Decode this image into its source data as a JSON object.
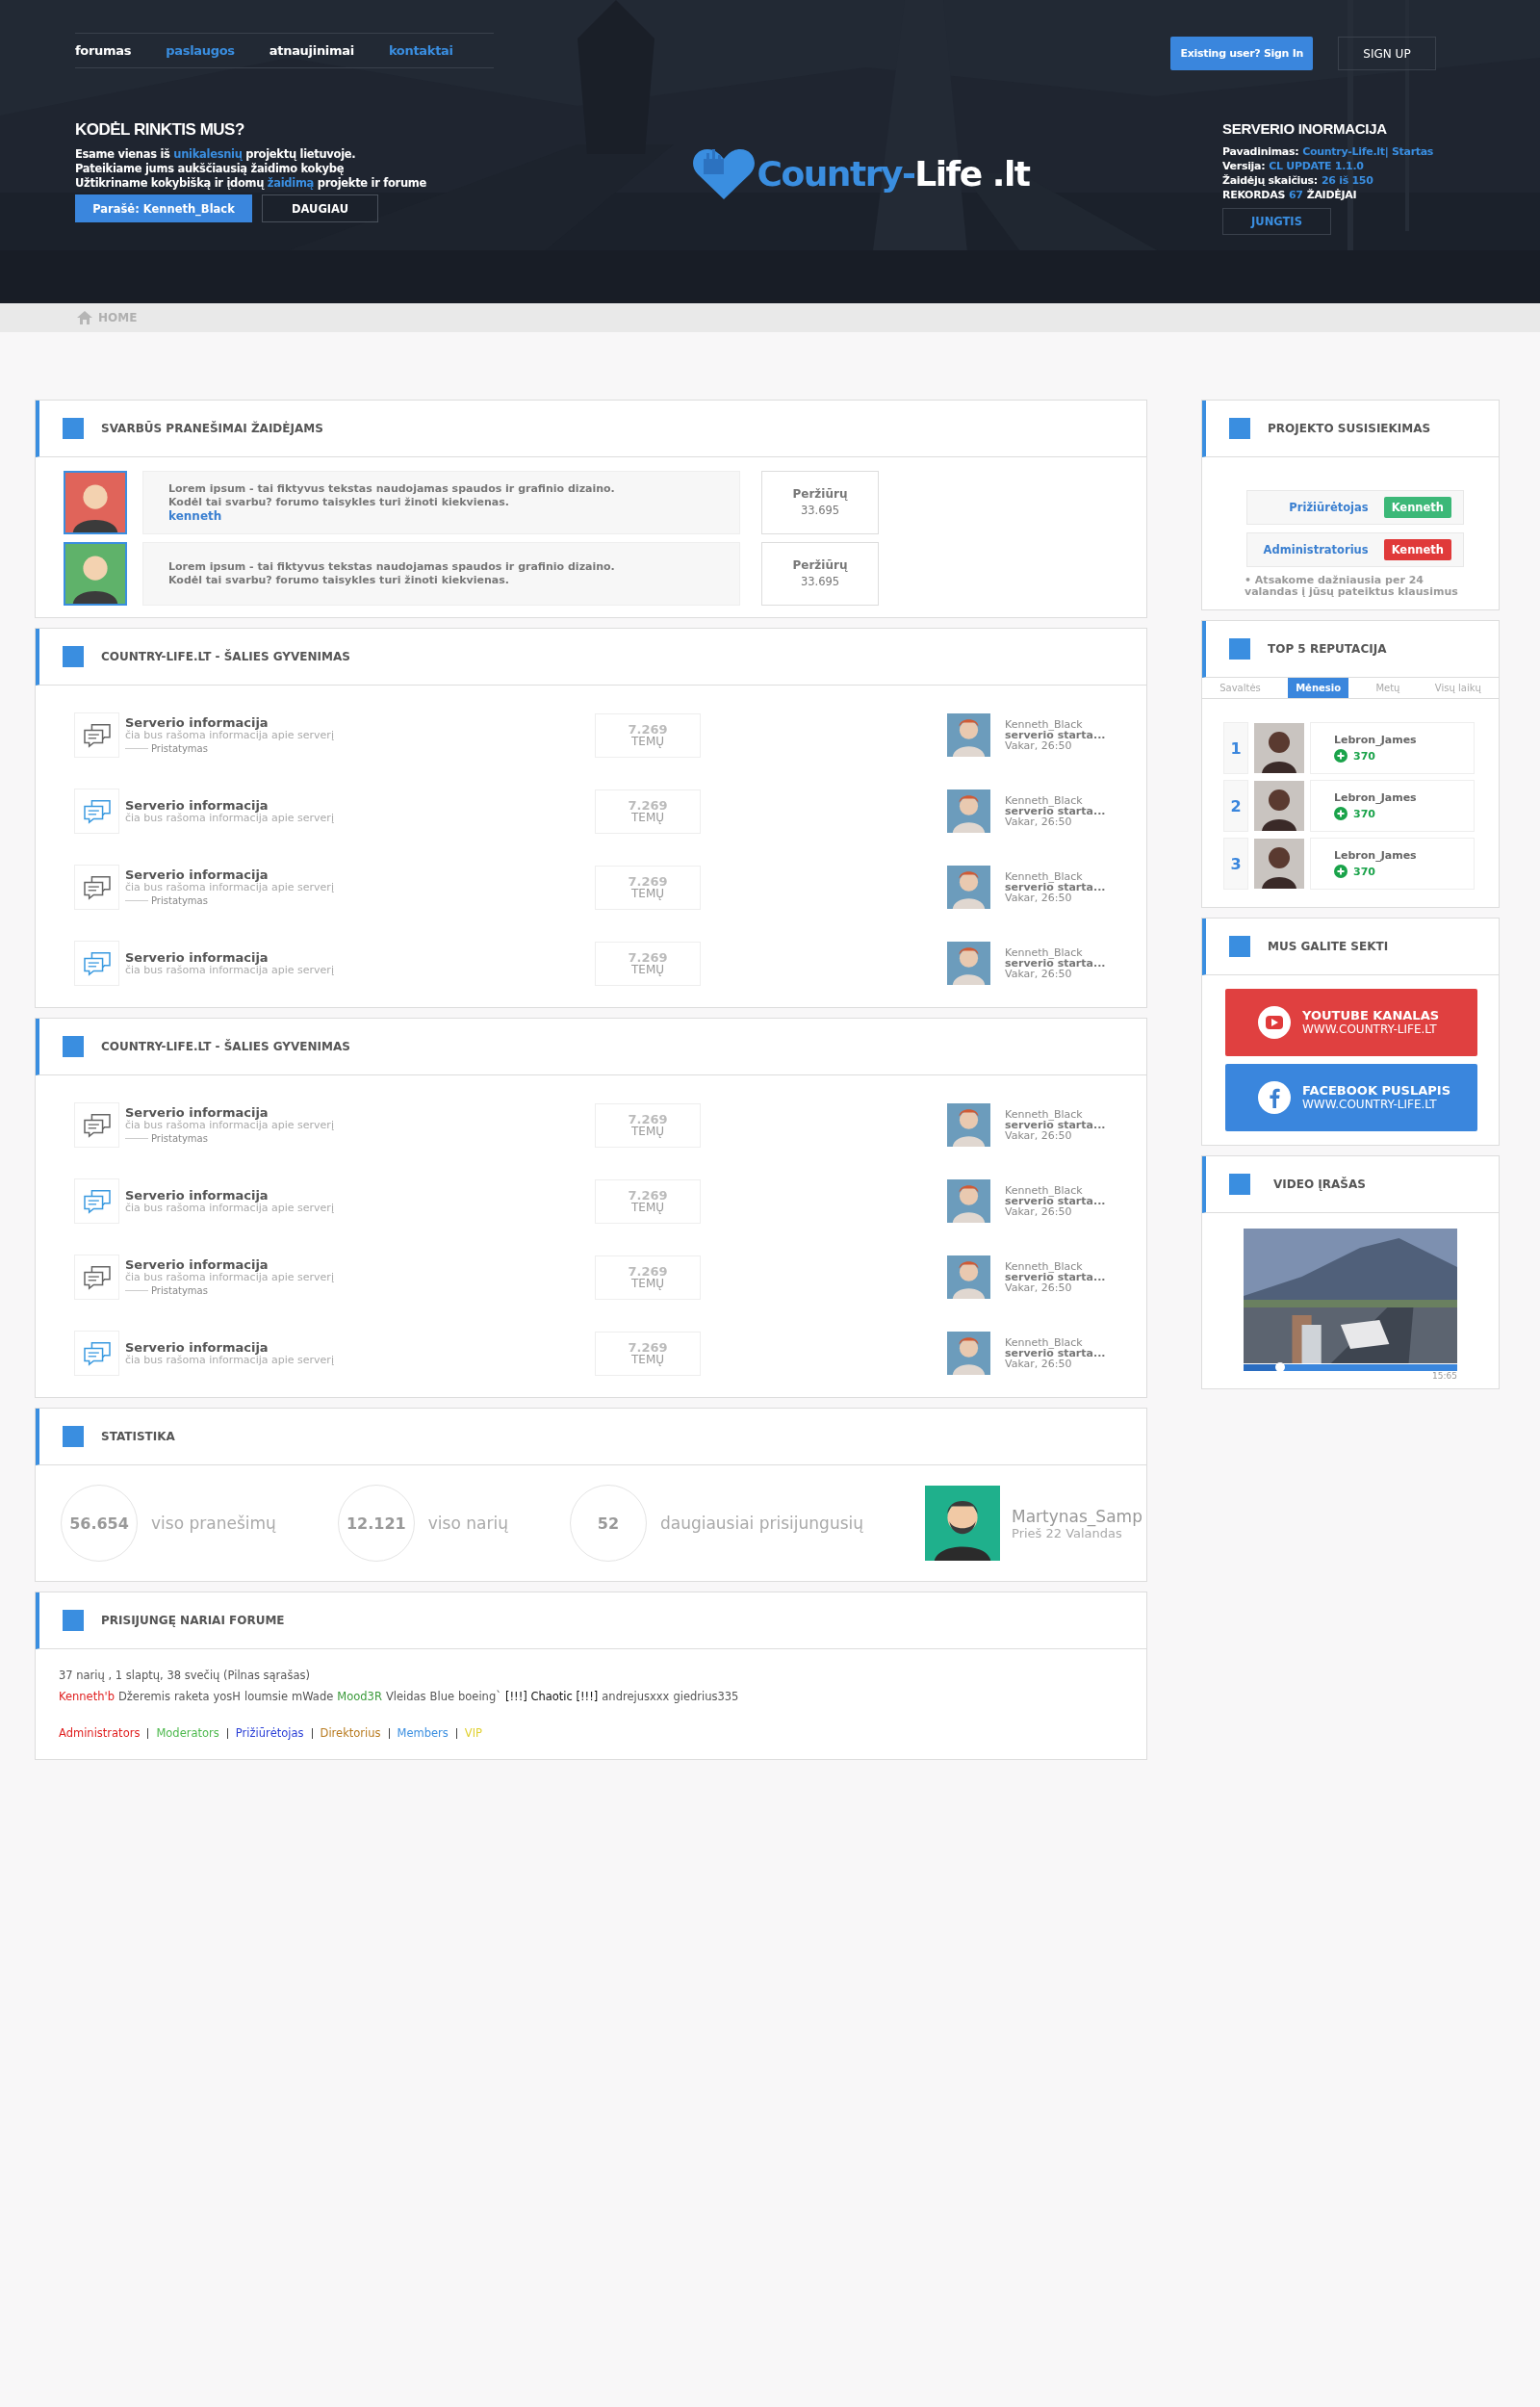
{
  "nav": [
    {
      "label": "forumas",
      "highlight": false
    },
    {
      "label": "paslaugos",
      "highlight": true
    },
    {
      "label": "atnaujinimai",
      "highlight": false
    },
    {
      "label": "kontaktai",
      "highlight": true
    }
  ],
  "auth": {
    "sign_in": "Existing user? Sign In",
    "sign_up": "SIGN UP"
  },
  "why": {
    "title": "KODĖL RINKTIS MUS?",
    "lines": [
      "Esame vienas iš **unikalesnių** projektų lietuvoje.",
      "Pateikiame jums aukščiausią žaidimo kokybę",
      "Užtikriname kokybišką ir įdomų **žaidimą** projekte ir forume"
    ],
    "primary_button": "Parašė: Kenneth_Black",
    "secondary_button": "DAUGIAU"
  },
  "logo": {
    "first": "Country-",
    "second": "Life .lt"
  },
  "server": {
    "title": "SERVERIO INORMACIJA",
    "rows": [
      {
        "label": "Pavadinimas:",
        "value": "Country-Life.lt| Startas"
      },
      {
        "label": "Versija:",
        "value": "CL UPDATE 1.1.0"
      },
      {
        "label": "Žaidėjų skaičius:",
        "value": "26 iš 150"
      }
    ],
    "record": "REKORDAS **67** ŽAIDĖJAI",
    "button": "JUNGTIS"
  },
  "breadcrumb": "HOME",
  "announcements": {
    "title": "SVARBŪS PRANEŠIMAI ŽAIDĖJAMS",
    "items": [
      {
        "color": "#e0645a",
        "lines": [
          "Lorem ipsum - tai fiktyvus tekstas naudojamas spaudos ir grafinio dizaino.",
          "Kodėl tai svarbu? forumo taisykles turi žinoti kiekvienas."
        ],
        "author": "kenneth",
        "views_label": "Peržiūrų",
        "views": "33.695"
      },
      {
        "color": "#5fb26a",
        "lines": [
          "Lorem ipsum - tai fiktyvus tekstas naudojamas spaudos ir grafinio dizaino.",
          "Kodėl tai svarbu? forumo taisykles turi žinoti kiekvienas."
        ],
        "views_label": "Peržiūrų",
        "views": "33.695"
      }
    ]
  },
  "forum_sections": [
    {
      "title": "COUNTRY-LIFE.LT - ŠALIES GYVENIMAS",
      "forums": [
        {
          "unread": false,
          "title": "Serverio informacija",
          "description": "čia bus rašoma informacija apie serverį",
          "subforum": "Pristatymas",
          "count": "7.269",
          "count_label": "TEMŲ",
          "last_user": "Kenneth_Black",
          "last_topic": "serverio starta...",
          "last_time": "Vakar, 26:50"
        },
        {
          "unread": true,
          "title": "Serverio informacija",
          "description": "čia bus rašoma informacija apie serverį",
          "count": "7.269",
          "count_label": "TEMŲ",
          "last_user": "Kenneth_Black",
          "last_topic": "serverio starta...",
          "last_time": "Vakar, 26:50"
        },
        {
          "unread": false,
          "title": "Serverio informacija",
          "description": "čia bus rašoma informacija apie serverį",
          "subforum": "Pristatymas",
          "count": "7.269",
          "count_label": "TEMŲ",
          "last_user": "Kenneth_Black",
          "last_topic": "serverio starta...",
          "last_time": "Vakar, 26:50"
        },
        {
          "unread": true,
          "title": "Serverio informacija",
          "description": "čia bus rašoma informacija apie serverį",
          "count": "7.269",
          "count_label": "TEMŲ",
          "last_user": "Kenneth_Black",
          "last_topic": "serverio starta...",
          "last_time": "Vakar, 26:50"
        }
      ]
    },
    {
      "title": "COUNTRY-LIFE.LT - ŠALIES GYVENIMAS",
      "forums": [
        {
          "unread": false,
          "title": "Serverio informacija",
          "description": "čia bus rašoma informacija apie serverį",
          "subforum": "Pristatymas",
          "count": "7.269",
          "count_label": "TEMŲ",
          "last_user": "Kenneth_Black",
          "last_topic": "serverio starta...",
          "last_time": "Vakar, 26:50"
        },
        {
          "unread": true,
          "title": "Serverio informacija",
          "description": "čia bus rašoma informacija apie serverį",
          "count": "7.269",
          "count_label": "TEMŲ",
          "last_user": "Kenneth_Black",
          "last_topic": "serverio starta...",
          "last_time": "Vakar, 26:50"
        },
        {
          "unread": false,
          "title": "Serverio informacija",
          "description": "čia bus rašoma informacija apie serverį",
          "subforum": "Pristatymas",
          "count": "7.269",
          "count_label": "TEMŲ",
          "last_user": "Kenneth_Black",
          "last_topic": "serverio starta...",
          "last_time": "Vakar, 26:50"
        },
        {
          "unread": true,
          "title": "Serverio informacija",
          "description": "čia bus rašoma informacija apie serverį",
          "count": "7.269",
          "count_label": "TEMŲ",
          "last_user": "Kenneth_Black",
          "last_topic": "serverio starta...",
          "last_time": "Vakar, 26:50"
        }
      ]
    }
  ],
  "statistics": {
    "title": "STATISTIKA",
    "items": [
      {
        "value": "56.654",
        "label": "viso pranešimų"
      },
      {
        "value": "12.121",
        "label": "viso narių"
      },
      {
        "value": "52",
        "label": "daugiausiai prisijungusių"
      }
    ],
    "newest": {
      "name": "Martynas_Samp",
      "time": "Prieš 22 Valandas"
    }
  },
  "online": {
    "title": "PRISIJUNGĘ NARIAI FORUME",
    "summary": "37 narių , 1 slaptų, 38 svečių (Pilnas sąrašas)",
    "members": [
      {
        "name": "Kenneth'b",
        "color": "#e02020"
      },
      {
        "name": "Džeremis",
        "color": "#555555"
      },
      {
        "name": "raketa",
        "color": "#555555"
      },
      {
        "name": "yosH",
        "color": "#555555"
      },
      {
        "name": "loumsie",
        "color": "#555555"
      },
      {
        "name": "mWade",
        "color": "#555555"
      },
      {
        "name": "Mood3R",
        "color": "#3a9a3a"
      },
      {
        "name": "Vleidas",
        "color": "#555555"
      },
      {
        "name": "Blue",
        "color": "#555555"
      },
      {
        "name": "boeing`",
        "color": "#555555"
      },
      {
        "name": "[!!!] Chaotic [!!!]",
        "color": "#111111"
      },
      {
        "name": "andrejusxxx",
        "color": "#555555"
      },
      {
        "name": "giedrius335",
        "color": "#555555"
      }
    ],
    "groups": [
      {
        "name": "Administrators",
        "color": "#e02020"
      },
      {
        "name": "Moderators",
        "color": "#4cb84c"
      },
      {
        "name": "Prižiūrėtojas",
        "color": "#2a3fd6"
      },
      {
        "name": "Direktorius",
        "color": "#b87a1e"
      },
      {
        "name": "Members",
        "color": "#3a8ee0"
      },
      {
        "name": "VIP",
        "color": "#e0d030"
      }
    ]
  },
  "contacts": {
    "title": "PROJEKTO SUSISIEKIMAS",
    "items": [
      {
        "role": "Prižiūrėtojas",
        "name": "Kenneth",
        "color": "#3cb878"
      },
      {
        "role": "Administratorius",
        "name": "Kenneth",
        "color": "#e03a3a"
      }
    ],
    "note": "• Atsakome dažniausia per 24 valandas į jūsų pateiktus klausimus"
  },
  "reputation": {
    "title": "TOP 5 REPUTACIJA",
    "tabs": [
      {
        "label": "Savaltės",
        "selected": false
      },
      {
        "label": "Mėnesio",
        "selected": true
      },
      {
        "label": "Metų",
        "selected": false
      },
      {
        "label": "Visų laikų",
        "selected": false
      }
    ],
    "rows": [
      {
        "rank": "1",
        "name": "Lebron_James",
        "points": "370"
      },
      {
        "rank": "2",
        "name": "Lebron_James",
        "points": "370"
      },
      {
        "rank": "3",
        "name": "Lebron_James",
        "points": "370"
      }
    ]
  },
  "follow": {
    "title": "MUS GALITE SEKTI",
    "links": [
      {
        "kind": "youtube",
        "title": "YOUTUBE KANALAS",
        "url": "WWW.COUNTRY-LIFE.LT"
      },
      {
        "kind": "facebook",
        "title": "FACEBOOK PUSLAPIS",
        "url": "WWW.COUNTRY-LIFE.LT"
      }
    ]
  },
  "video": {
    "title": "VIDEO ĮRAŠAS",
    "level": 0.17,
    "time": "15:65"
  }
}
